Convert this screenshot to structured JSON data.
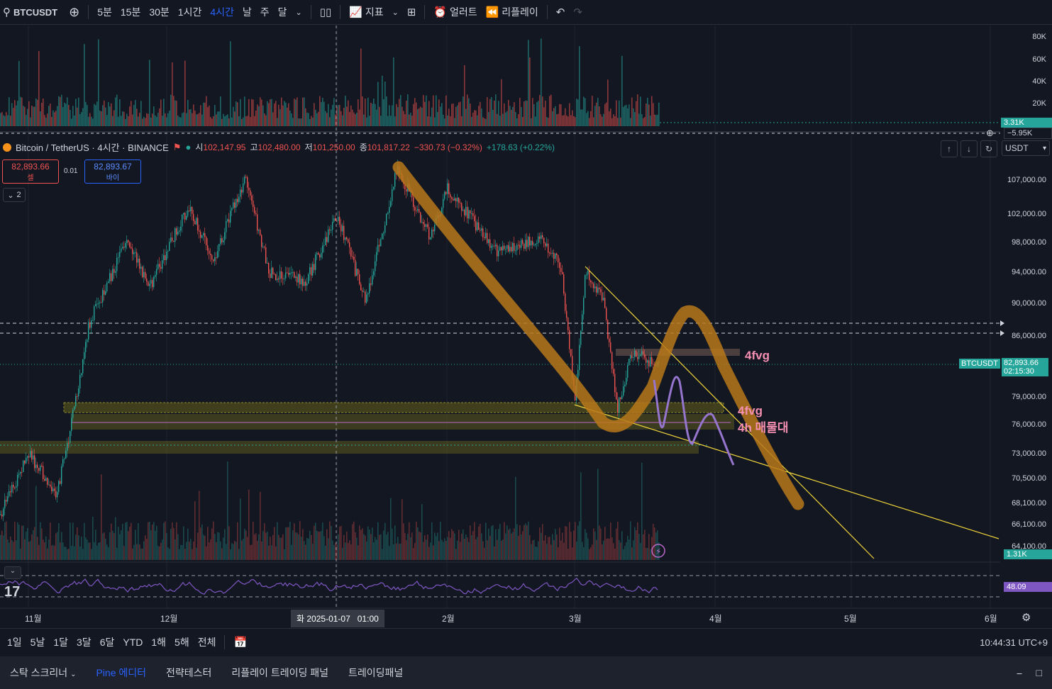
{
  "toolbar": {
    "symbol": "BTCUSDT",
    "intervals": [
      "5분",
      "15분",
      "30분",
      "1시간",
      "4시간",
      "날",
      "주",
      "달"
    ],
    "active_interval": "4시간",
    "indicators_label": "지표",
    "alert_label": "얼러트",
    "replay_label": "리플레이"
  },
  "legend": {
    "title": "Bitcoin / TetherUS · 4시간 · BINANCE",
    "open_label": "시",
    "open": "102,147.95",
    "high_label": "고",
    "high": "102,480.00",
    "low_label": "저",
    "low": "101,250.00",
    "close_label": "종",
    "close": "101,817.22",
    "change": "−330.73 (−0.32%)",
    "change2": "+178.63 (+0.22%)"
  },
  "trade": {
    "sell_price": "82,893.66",
    "sell_label": "셀",
    "spread": "0.01",
    "buy_price": "82,893.67",
    "buy_label": "바이",
    "collapse_count": "2"
  },
  "currency": "USDT",
  "volume_scale": [
    "80K",
    "60K",
    "40K",
    "20K"
  ],
  "volume_last": "3.31K",
  "volume_neg": "−5.95K",
  "price_scale": [
    "107,000.00",
    "102,000.00",
    "98,000.00",
    "94,000.00",
    "90,000.00",
    "86,000.00",
    "79,000.00",
    "76,000.00",
    "73,000.00",
    "70,500.00",
    "68,100.00",
    "66,100.00",
    "64,100.00"
  ],
  "last_price_tag": {
    "symbol": "BTCUSDT",
    "price": "82,893.66",
    "countdown": "02:15:30"
  },
  "vol_tag2": "1.31K",
  "rsi_value": "48.09",
  "annotations": {
    "fvg1": "4fvg",
    "fvg2": "4fvg",
    "zone": "4h 매물대"
  },
  "xaxis": {
    "labels": [
      "11월",
      "12월",
      "2월",
      "3월",
      "4월",
      "5월",
      "6월"
    ],
    "crosshair": "화 2025-01-07   01:00"
  },
  "ranges": [
    "1일",
    "5날",
    "1달",
    "3달",
    "6달",
    "YTD",
    "1해",
    "5해",
    "전체"
  ],
  "clock": "10:44:31 UTC+9",
  "footer_tabs": [
    "스탁 스크리너",
    "Pine 에디터",
    "전략테스터",
    "리플레이 트레이딩 패널",
    "트레이딩패널"
  ],
  "colors": {
    "up": "#26a69a",
    "down": "#ef5350",
    "accent": "#2962ff",
    "rsi": "#7e57c2",
    "trend": "#b8781a"
  }
}
